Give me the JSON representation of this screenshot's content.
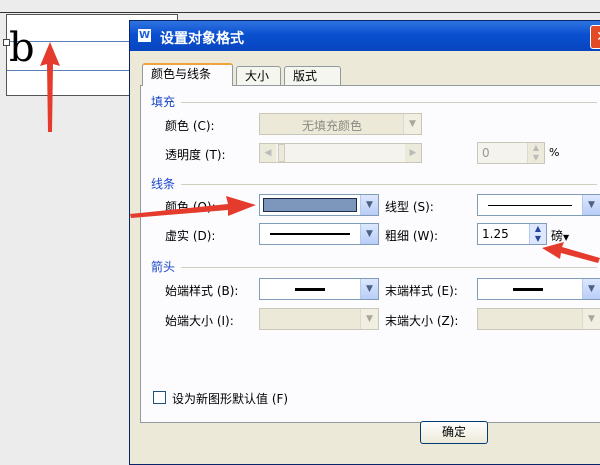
{
  "document": {
    "letter": "b"
  },
  "dialog": {
    "title": "设置对象格式",
    "tabs": [
      "颜色与线条",
      "大小",
      "版式"
    ],
    "fill": {
      "section_title": "填充",
      "color_label": "颜色 (C):",
      "color_value": "无填充颜色",
      "transparency_label": "透明度 (T):",
      "transparency_value": "0",
      "percent_sign": "%"
    },
    "line": {
      "section_title": "线条",
      "color_label": "颜色 (O):",
      "color_value_hex": "#7d96bb",
      "style_label": "线型 (S):",
      "dash_label": "虚实 (D):",
      "weight_label": "粗细 (W):",
      "weight_value": "1.25",
      "weight_unit": "磅"
    },
    "arrows": {
      "section_title": "箭头",
      "begin_style_label": "始端样式 (B):",
      "end_style_label": "末端样式 (E):",
      "begin_size_label": "始端大小 (I):",
      "end_size_label": "末端大小 (Z):"
    },
    "default_checkbox_label": "设为新图形默认值 (F)",
    "ok_label": "确定"
  },
  "colors": {
    "titlebar": "#0a50d0",
    "annotation_arrow": "#e53b2c",
    "section_title": "#1a46c8"
  }
}
